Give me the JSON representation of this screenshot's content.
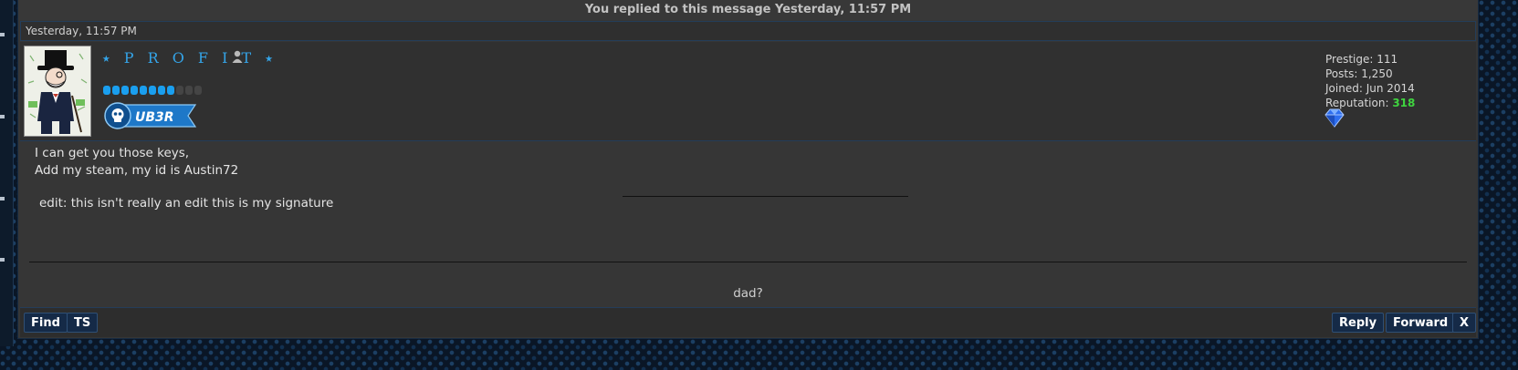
{
  "reply_notice": "You replied to this message Yesterday, 11:57 PM",
  "post": {
    "date": "Yesterday, 11:57 PM",
    "author": {
      "username": "⭑ P R O F I T ⭑",
      "rank_pips_filled": 8,
      "rank_pips_total": 11,
      "usergroup_badge": "UB3R",
      "avatar_icon": "monopoly-man-avatar",
      "status_icon": "user-offline-icon"
    },
    "stats": {
      "prestige_label": "Prestige:",
      "prestige": "111",
      "posts_label": "Posts:",
      "posts": "1,250",
      "joined_label": "Joined:",
      "joined": "Jun 2014",
      "reputation_label": "Reputation:",
      "reputation": "318",
      "award_icon": "diamond-gem-icon"
    },
    "body_lines": [
      "I can get you those keys,",
      "Add my steam, my id is Austin72",
      "edit: this isn't really an edit this is my signature"
    ],
    "signature": "dad?"
  },
  "buttons": {
    "find": "Find",
    "ts": "TS",
    "reply": "Reply",
    "forward": "Forward",
    "close": "X"
  },
  "colors": {
    "panel_bg": "#363636",
    "accent_blue": "#34a4e8",
    "reputation_green": "#3fd43f",
    "button_bg": "#152a47"
  }
}
